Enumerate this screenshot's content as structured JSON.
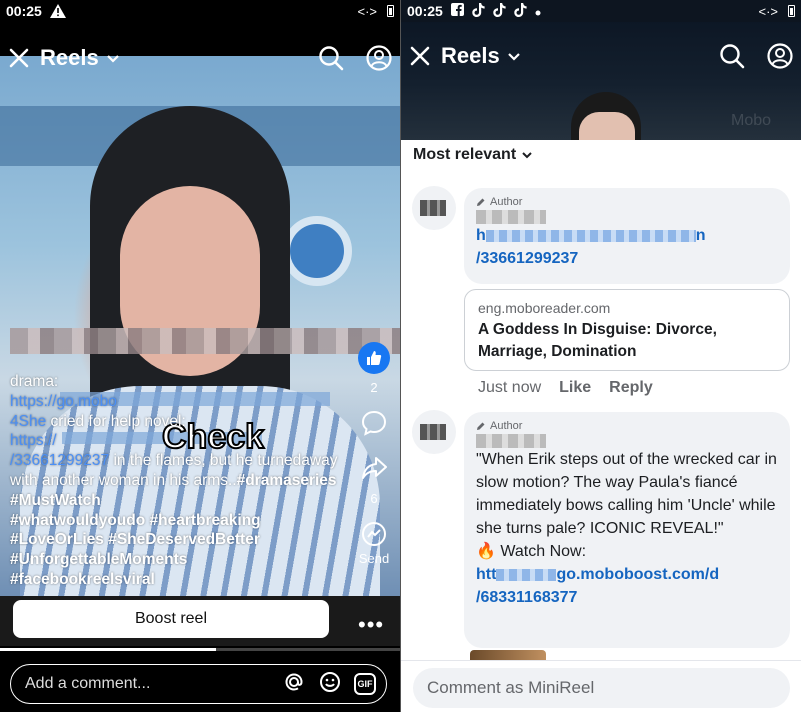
{
  "left": {
    "status": {
      "time": "00:25"
    },
    "header": {
      "title": "Reels"
    },
    "caption": {
      "prefix": "drama:",
      "link1": "https://go.mobo",
      "link1_tail": "4She",
      "text1": " cried for help  novel:",
      "link2_start": "https://",
      "link2_end": "/33661299237",
      "text2": " in the flames, but he turnedaway with another woman in his arms..",
      "tags": [
        "#dramaseries",
        "#MustWatch",
        "#whatwouldyoudo",
        "#heartbreaking",
        "#LoveOrLies",
        "#SheDeservedBetter",
        "#UnforgettableMoments",
        "#facebookreelsviral"
      ]
    },
    "overlay_word": "Check",
    "actions": {
      "likes": "2",
      "shares": "6",
      "send_label": "Send"
    },
    "boost_label": "Boost reel",
    "more_label": "•••",
    "progress": 0.54,
    "comment_placeholder": "Add a comment...",
    "gif_label": "GIF"
  },
  "right": {
    "status": {
      "time": "00:25"
    },
    "header": {
      "title": "Reels"
    },
    "watermark": "Mobo",
    "sort_label": "Most relevant",
    "comments": [
      {
        "badge": "Author",
        "link_start": "h",
        "link_end": "n",
        "link_line2": "/33661299237",
        "preview": {
          "domain": "eng.moboreader.com",
          "title": "A Goddess In Disguise: Divorce, Marriage, Domination"
        },
        "actions": {
          "time": "Just now",
          "like": "Like",
          "reply": "Reply"
        }
      },
      {
        "badge": "Author",
        "text": "\"When Erik steps out of the wrecked car in slow motion? The way Paula's fiancé immediately bows calling him 'Uncle' while she turns pale? ICONIC REVEAL!\"",
        "watch_icon": "🔥",
        "watch_label": " Watch Now:",
        "link_start": "htt",
        "link_mid": "go.moboboost.com/d",
        "link_line2": "/68331168377"
      }
    ],
    "comment_placeholder": "Comment as MiniReel"
  }
}
